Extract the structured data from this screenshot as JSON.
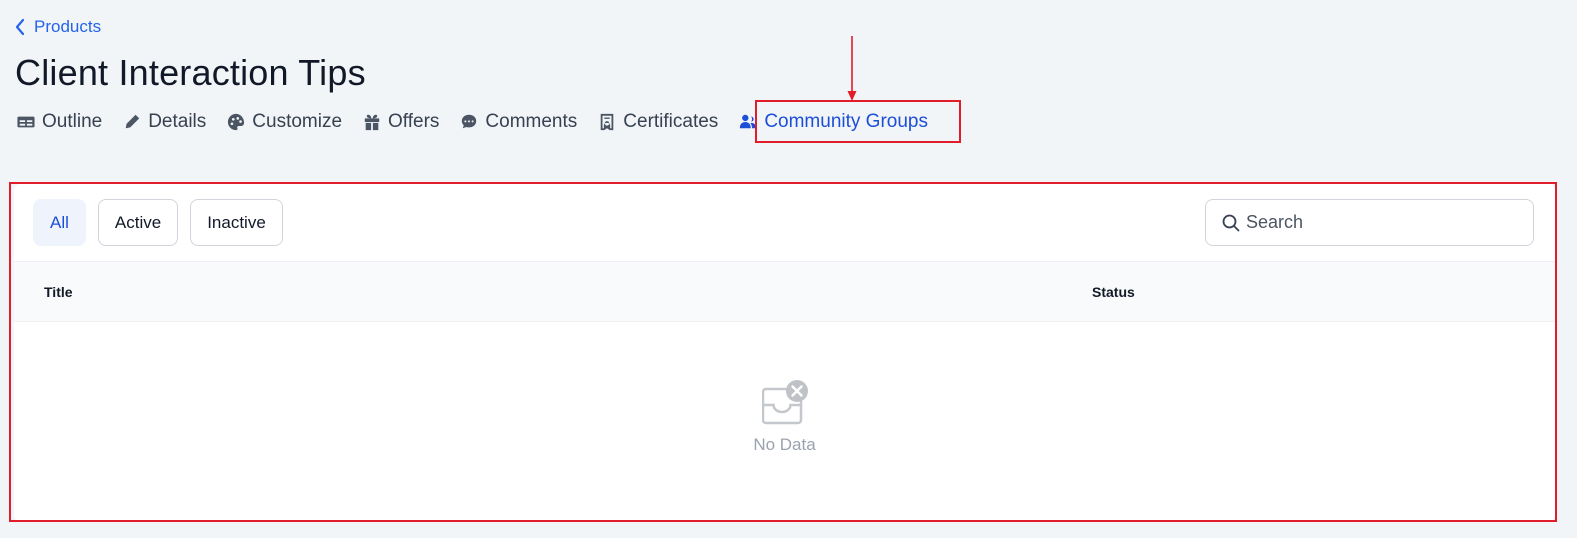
{
  "breadcrumb": {
    "label": "Products",
    "icon": "chevron-left-icon"
  },
  "page": {
    "title": "Client Interaction Tips"
  },
  "tabs": [
    {
      "label": "Outline",
      "icon": "outline-icon"
    },
    {
      "label": "Details",
      "icon": "pencil-icon"
    },
    {
      "label": "Customize",
      "icon": "palette-icon"
    },
    {
      "label": "Offers",
      "icon": "gift-icon"
    },
    {
      "label": "Comments",
      "icon": "comment-icon"
    },
    {
      "label": "Certificates",
      "icon": "certificate-icon"
    },
    {
      "label": "Community Groups",
      "icon": "users-icon",
      "active": true
    }
  ],
  "filters": {
    "all": "All",
    "active": "Active",
    "inactive": "Inactive",
    "selected": "All"
  },
  "search": {
    "placeholder": "Search",
    "value": ""
  },
  "table": {
    "columns": [
      "Title",
      "Status"
    ],
    "empty_text": "No Data"
  },
  "colors": {
    "accent": "#1d4ed8",
    "annotation": "#e11d2a",
    "background": "#f1f5f8"
  }
}
